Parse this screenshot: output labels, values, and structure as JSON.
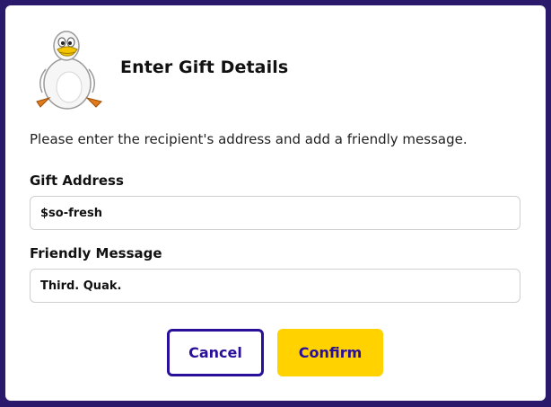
{
  "colors": {
    "backdrop": "#2b1a6b",
    "dialog_background": "#ffffff",
    "accent_purple": "#2a0f9a",
    "confirm_yellow": "#ffd200"
  },
  "dialog": {
    "mascot_icon": "duck-mascot-icon",
    "title": "Enter Gift Details",
    "description": "Please enter the recipient's address and add a friendly message.",
    "fields": {
      "address": {
        "label": "Gift Address",
        "value": "$so-fresh"
      },
      "message": {
        "label": "Friendly Message",
        "value": "Third. Quak."
      }
    },
    "buttons": {
      "cancel": "Cancel",
      "confirm": "Confirm"
    }
  }
}
